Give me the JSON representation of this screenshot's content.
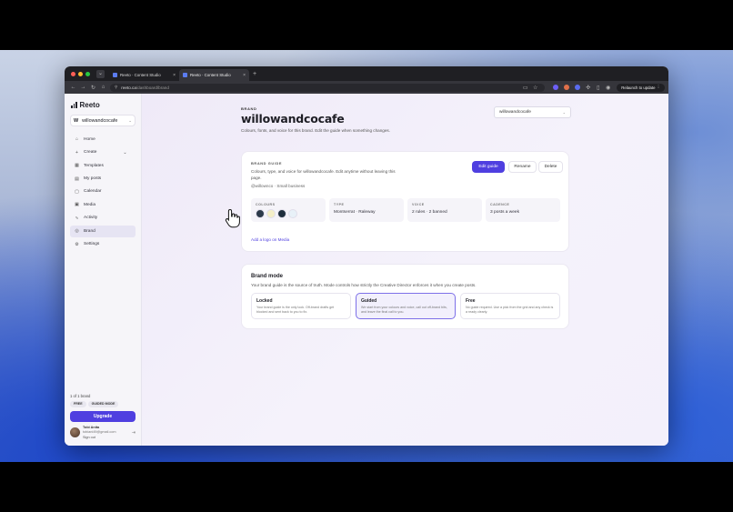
{
  "browser": {
    "tabs": [
      {
        "label": "Reeto · Content Studio",
        "close": "×"
      },
      {
        "label": "Reeto · Content Studio",
        "close": "×"
      }
    ],
    "new_tab": "+",
    "url_host": "reeto.ca",
    "url_path": "/dashboard/brand",
    "relaunch_label": "Relaunch to update"
  },
  "sidebar": {
    "logo": "Reeto",
    "workspace": {
      "initial": "W",
      "name": "willowandcocafe"
    },
    "items": [
      {
        "label": "Home",
        "icon": "⌂"
      },
      {
        "label": "Create",
        "icon": "+",
        "chevron": "⌄"
      },
      {
        "label": "Templates",
        "icon": "▦"
      },
      {
        "label": "My posts",
        "icon": "▤"
      },
      {
        "label": "Calendar",
        "icon": "▢"
      },
      {
        "label": "Media",
        "icon": "▣"
      },
      {
        "label": "Activity",
        "icon": "∿"
      },
      {
        "label": "Brand",
        "icon": "◎"
      },
      {
        "label": "Settings",
        "icon": "⚙"
      }
    ],
    "plan_text": "1 of 1 brand",
    "pills": [
      "FREE",
      "GUIDED MODE"
    ],
    "upgrade_label": "Upgrade",
    "user": {
      "name": "Tobi Anita",
      "email": "tobiani49@gmail.com",
      "sign_out": "Sign out"
    }
  },
  "header": {
    "eyebrow": "BRAND",
    "title": "willowandcocafe",
    "subtitle": "Colours, fonts, and voice for this brand. Edit the guide when something changes.",
    "brand_select": "willowandcocafe"
  },
  "guide": {
    "eyebrow": "BRAND GUIDE",
    "description": "Colours, type, and voice for willowandcocafe. Edit anytime without leaving this page.",
    "tags": "@willownco · Small business",
    "edit_label": "Edit guide",
    "rename_label": "Rename",
    "delete_label": "Delete",
    "stats": {
      "colours_label": "COLOURS",
      "type_label": "TYPE",
      "type_value": "Montserrat · Raleway",
      "voice_label": "VOICE",
      "voice_value": "2 rules · 2 banned",
      "cadence_label": "CADENCE",
      "cadence_value": "3 posts a week"
    },
    "swatches": [
      "#2c3a4a",
      "#f4efc8",
      "#1f2f3d",
      "#e8f1f8"
    ],
    "add_logo": "Add a logo on Media"
  },
  "mode": {
    "title": "Brand mode",
    "subtitle": "Your brand guide is the source of truth. Mode controls how strictly the Creative Director enforces it when you create posts.",
    "options": [
      {
        "title": "Locked",
        "desc": "Your brand guide is the only look. Off-brand drafts get blocked and sent back to you to fix."
      },
      {
        "title": "Guided",
        "desc": "We start from your colours and voice, call out off-brand bits, and leave the final call to you."
      },
      {
        "title": "Free",
        "desc": "No guide required. Use a pick from the grid and any check is a ready clearly."
      }
    ]
  },
  "colors": {
    "accent": "#4f3fe0"
  }
}
